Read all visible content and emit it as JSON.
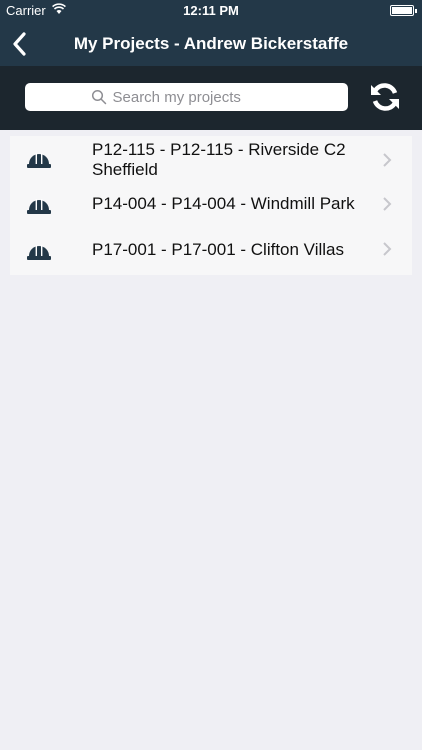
{
  "status": {
    "carrier": "Carrier",
    "time": "12:11 PM"
  },
  "nav": {
    "title": "My Projects - Andrew Bickerstaffe"
  },
  "search": {
    "placeholder": "Search my projects",
    "value": ""
  },
  "projects": [
    {
      "line1": "P12-115 - P12-115    - Riverside C2",
      "line2": "Sheffield"
    },
    {
      "line1": "P14-004 - P14-004 - Windmill Park"
    },
    {
      "line1": "P17-001 - P17-001 - Clifton Villas"
    }
  ],
  "colors": {
    "header": "#233848",
    "search_bar": "#1c262e",
    "background": "#efeff4",
    "icon": "#233848"
  },
  "icons": {
    "back": "chevron-left-icon",
    "search": "search-icon",
    "refresh": "refresh-icon",
    "project": "hard-hat-icon",
    "row": "chevron-right-icon"
  }
}
